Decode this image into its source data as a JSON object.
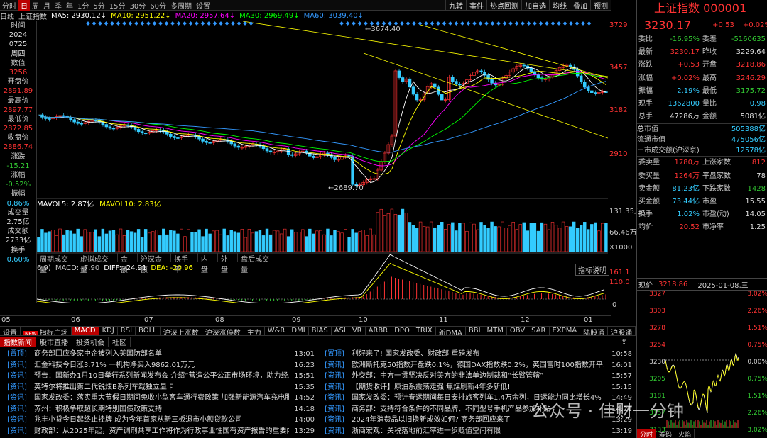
{
  "toolbar": {
    "left": [
      "分时",
      "日",
      "周",
      "月",
      "季",
      "年",
      "1分",
      "5分",
      "15分",
      "30分",
      "60分",
      "多周期",
      "设置"
    ],
    "selected": "日",
    "right": [
      "九转",
      "事件",
      "热点回测",
      "加自选",
      "均线",
      "叠加",
      "预测"
    ]
  },
  "ma": {
    "period_label": "日线",
    "index_name": "上证指数",
    "ma5": "MA5: 2930.12↓",
    "ma10": "MA10: 2951.22↓",
    "ma20": "MA20: 2957.64↓",
    "ma30": "MA30: 2969.49↓",
    "ma60": "MA60: 3039.40↓"
  },
  "left_info": [
    [
      "时间",
      "lbl"
    ],
    [
      "2024",
      "wht"
    ],
    [
      "0725",
      "wht"
    ],
    [
      "周四",
      "wht"
    ],
    [
      "数值",
      "lbl"
    ],
    [
      "3256",
      "val"
    ],
    [
      "开盘价",
      "lbl"
    ],
    [
      "2891.89",
      "val"
    ],
    [
      "最高价",
      "lbl"
    ],
    [
      "2897.77",
      "val"
    ],
    [
      "最低价",
      "lbl"
    ],
    [
      "2872.85",
      "val"
    ],
    [
      "收盘价",
      "lbl"
    ],
    [
      "2886.74",
      "val"
    ],
    [
      "涨跌",
      "lbl"
    ],
    [
      "-15.21",
      "valg"
    ],
    [
      "涨幅",
      "lbl"
    ],
    [
      "-0.52%",
      "valg"
    ],
    [
      "振幅",
      "lbl"
    ],
    [
      "0.86%",
      "valc"
    ],
    [
      "成交量",
      "lbl"
    ],
    [
      "2.75亿",
      "wht"
    ],
    [
      "成交额",
      "lbl"
    ],
    [
      "2733亿",
      "wht"
    ],
    [
      "换手",
      "lbl"
    ],
    [
      "0.60%",
      "valc"
    ]
  ],
  "price_axis": [
    "3729",
    "3457",
    "3182",
    "2910"
  ],
  "annotations": {
    "high": "3674.40",
    "low": "2689.70"
  },
  "vol": {
    "mavol5": "MAVOL5: 2.87亿",
    "mavol10": "MAVOL10: 2.83亿",
    "axis": [
      "131.35万",
      "66.46万",
      "X1000"
    ]
  },
  "subtabs": [
    "周期成交量",
    "虚拟成交量",
    "金额",
    "沪深金额",
    "换手率",
    "内盘",
    "外盘",
    "盘后成交量"
  ],
  "macd": {
    "params": "6,9)",
    "macd": "MACD: -7.90",
    "diff": "DIFF: -24.91",
    "dea": "DEA: -20.96",
    "explain": "指标说明",
    "axis": [
      "161.1",
      "110.0",
      "0"
    ]
  },
  "xaxis": [
    "05",
    "06",
    "07",
    "08",
    "09",
    "10",
    "11",
    "12",
    "01"
  ],
  "indicators": [
    "设置",
    "指标广场",
    "MACD",
    "KDJ",
    "RSI",
    "BOLL",
    "沪深上涨数",
    "沪深涨停数",
    "主力",
    "W&R",
    "DMI",
    "BIAS",
    "ASI",
    "VR",
    "ARBR",
    "DPO",
    "TRIX",
    "新DMA",
    "BBI",
    "MTM",
    "OBV",
    "SAR",
    "EXPMA",
    "陆股通",
    "沪股通"
  ],
  "indicators_selected": "MACD",
  "newstabs": [
    "指数新闻",
    "股市直播",
    "投资机会",
    "社区"
  ],
  "news_left": [
    [
      "置顶",
      "商务部回应多家中企被列入美国防部名单",
      "13:01"
    ],
    [
      "资讯",
      "汇金科技今日涨3.71% 一机构净买入9862.01万元",
      "16:23"
    ],
    [
      "资讯",
      "预告：国新办1月10日举行系列新闻发布会 介绍“营造公平公正市场环境，助力经...",
      "15:51"
    ],
    [
      "资讯",
      "英特尔将推出第二代锐炫B系列车载独立显卡",
      "15:35"
    ],
    [
      "资讯",
      "国家发改委：落实重大节假日期间免收小型客车通行费政策 加强新能源汽车充电服...",
      "14:52"
    ],
    [
      "资讯",
      "苏州：积极争取超长期特别国债政策支持",
      "14:18"
    ],
    [
      "资讯",
      "兆丰小贷今日起终止挂牌 成为今年首家从新三板退市小额贷款公司",
      "14:00"
    ],
    [
      "资讯",
      "财政部：从2025年起，资产调剂共享工作将作为行政事业性国有资产报告的重要内...",
      "13:29"
    ]
  ],
  "news_right": [
    [
      "置顶",
      "利好来了! 国家发改委、财政部 重磅发布",
      "10:58"
    ],
    [
      "资讯",
      "欧洲斯托克50指数开盘跌0.1%，德国DAX指数跌0.2%，英国富时100指数开平...",
      "16:01"
    ],
    [
      "资讯",
      "外交部：中方一贯坚决反对美方的非法单边制裁和“长臂管辖”",
      "15:57"
    ],
    [
      "资讯",
      "【期货收评】原油系震荡走强 焦煤刷新4年多新低!",
      "15:15"
    ],
    [
      "资讯",
      "国家发改委：预计春运期间每日安排旅客列车1.4万余列，日运能力同比增长4%",
      "14:49"
    ],
    [
      "资讯",
      "商务部：支持符合条件的不同品牌、不同型号手机产品参加补贴",
      "14:21"
    ],
    [
      "资讯",
      "2024年消费品以旧换新成效如何? 商务部回应来了",
      "13:29"
    ],
    [
      "资讯",
      "浙商宏观：关税落地前汇率进一步贬值空间有限",
      "13:19"
    ]
  ],
  "right_panel": {
    "title": "上证指数 000001",
    "price": "3230.17",
    "change": "+0.53",
    "pct": "+0.02%",
    "rows": [
      [
        [
          "委比",
          "-16.95%",
          "grn"
        ],
        [
          "委差",
          "-5160635",
          "grn"
        ]
      ],
      [
        [
          "最新",
          "3230.17",
          "red"
        ],
        [
          "昨收",
          "3229.64",
          "wht"
        ]
      ],
      [
        [
          "涨跌",
          "+0.53",
          "red"
        ],
        [
          "开盘",
          "3218.86",
          "red"
        ]
      ],
      [
        [
          "涨幅",
          "+0.02%",
          "red"
        ],
        [
          "最高",
          "3246.29",
          "red"
        ]
      ],
      [
        [
          "振幅",
          "2.19%",
          "cyan"
        ],
        [
          "最低",
          "3175.72",
          "grn"
        ]
      ],
      [
        [
          "现手",
          "1362800",
          "cyan"
        ],
        [
          "量比",
          "0.98",
          "cyan"
        ]
      ],
      [
        [
          "总手",
          "47286万",
          "wht"
        ],
        [
          "金额",
          "5081亿",
          "wht"
        ]
      ]
    ],
    "cap": [
      [
        "总市值",
        "505388亿"
      ],
      [
        "流通市值",
        "475056亿"
      ],
      [
        "三市成交额(沪深京)",
        "12578亿"
      ]
    ],
    "rows2": [
      [
        [
          "委卖量",
          "1780万",
          "red"
        ],
        [
          "上涨家数",
          "812",
          "red"
        ]
      ],
      [
        [
          "委买量",
          "1264万",
          "red"
        ],
        [
          "平盘家数",
          "78",
          "wht"
        ]
      ],
      [
        [
          "卖金额",
          "81.23亿",
          "cyan"
        ],
        [
          "下跌家数",
          "1428",
          "grn"
        ]
      ],
      [
        [
          "买金额",
          "73.44亿",
          "cyan"
        ],
        [
          "市盈",
          "15.55",
          "wht"
        ]
      ],
      [
        [
          "换手",
          "1.02%",
          "cyan"
        ],
        [
          "市盈(动)",
          "14.05",
          "wht"
        ]
      ],
      [
        [
          "均价",
          "20.52",
          "red"
        ],
        [
          "市净率",
          "1.25",
          "wht"
        ]
      ]
    ],
    "mini": {
      "label": "现价",
      "price": "3218.86",
      "date": "2025-01-08,三",
      "left_axis": [
        "3327",
        "3303",
        "3278",
        "3254",
        "3230",
        "3205",
        "3181",
        "3157",
        "3133"
      ],
      "right_axis": [
        "3.02%",
        "2.26%",
        "1.51%",
        "0.75%",
        "0.00%",
        "0.75%",
        "1.51%",
        "2.26%",
        "3.02%"
      ],
      "tabs": [
        "分时",
        "筹码",
        "火焰"
      ]
    }
  },
  "watermark": "公众号 · 佳财一分钟"
}
